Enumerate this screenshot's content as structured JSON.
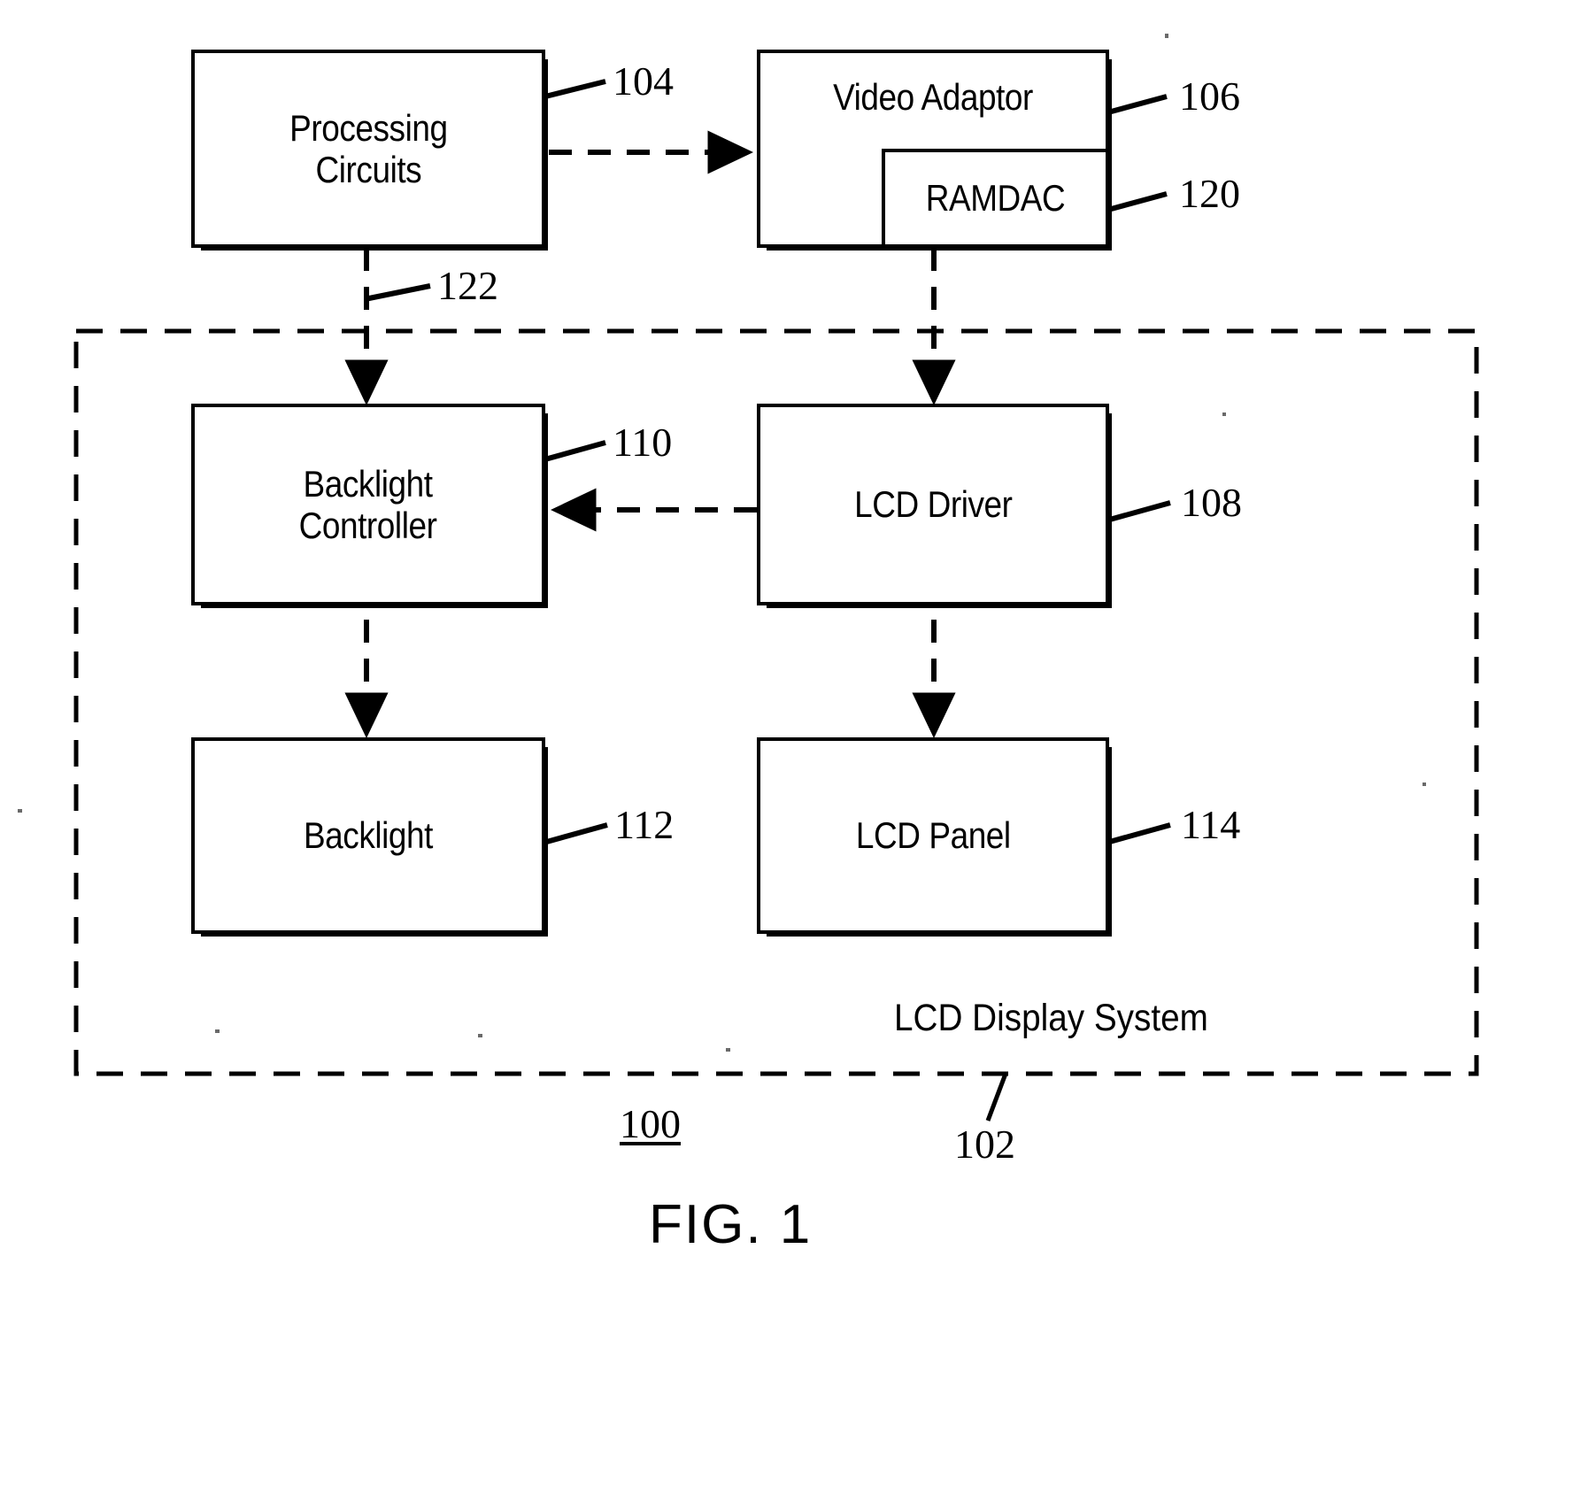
{
  "figure": {
    "caption": "FIG. 1",
    "system_label": "LCD Display System"
  },
  "blocks": {
    "processing_circuits": {
      "label": "Processing\nCircuits",
      "ref": "104"
    },
    "video_adaptor": {
      "label": "Video Adaptor",
      "ref": "106"
    },
    "ramdac": {
      "label": "RAMDAC",
      "ref": "120"
    },
    "backlight_controller": {
      "label": "Backlight\nController",
      "ref": "110"
    },
    "lcd_driver": {
      "label": "LCD Driver",
      "ref": "108"
    },
    "backlight": {
      "label": "Backlight",
      "ref": "112"
    },
    "lcd_panel": {
      "label": "LCD Panel",
      "ref": "114"
    }
  },
  "refs": {
    "system_boundary": "102",
    "whole_figure": "100",
    "backlight_signal": "122"
  },
  "colors": {
    "ink": "#000000",
    "paper": "#ffffff"
  }
}
